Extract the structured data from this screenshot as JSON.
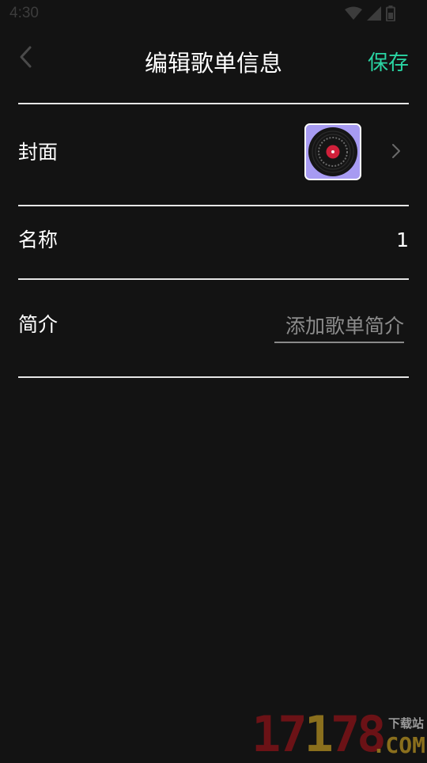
{
  "status_bar": {
    "time": "4:30"
  },
  "header": {
    "title": "编辑歌单信息",
    "save_label": "保存"
  },
  "colors": {
    "accent": "#2ad4a3",
    "background": "#131313",
    "divider": "#e6e6e6",
    "cover_bg": "#a79bf2"
  },
  "form": {
    "cover": {
      "label": "封面"
    },
    "name": {
      "label": "名称",
      "value": "1"
    },
    "intro": {
      "label": "简介",
      "placeholder": "添加歌单简介",
      "value": ""
    }
  },
  "watermark": {
    "digits_red_1": "17",
    "digits_gold": "1",
    "digits_red_2": "78",
    "subtitle": "下载站",
    "domain": ".COM"
  }
}
